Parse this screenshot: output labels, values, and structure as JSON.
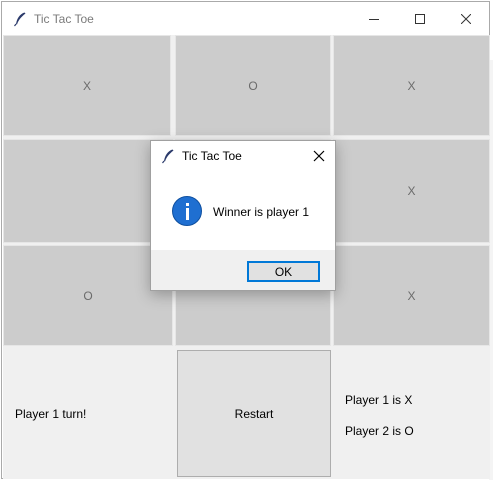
{
  "window": {
    "title": "Tic Tac Toe"
  },
  "board": {
    "cells": [
      "X",
      "O",
      "X",
      "",
      "",
      "X",
      "O",
      "",
      "X"
    ]
  },
  "status": {
    "text": "Player 1 turn!"
  },
  "restart_label": "Restart",
  "players": {
    "p1": "Player 1 is X",
    "p2": "Player 2 is O"
  },
  "dialog": {
    "title": "Tic Tac Toe",
    "message": "Winner is player 1",
    "ok_label": "OK",
    "icon": "info-icon"
  },
  "colors": {
    "cell_bg": "#cccccc",
    "dialog_accent": "#0078d7",
    "info_icon": "#1f6fd1"
  }
}
